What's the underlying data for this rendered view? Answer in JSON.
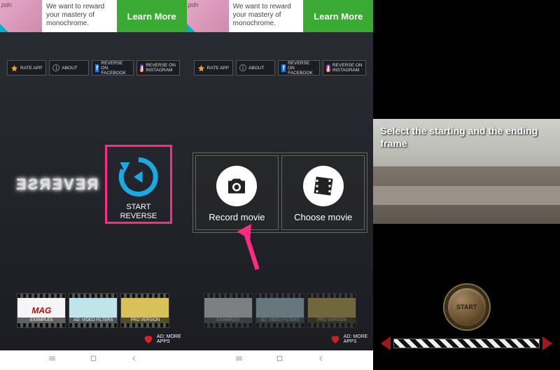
{
  "ad": {
    "text": "We want to reward your mastery of monochrome.",
    "cta": "Learn More"
  },
  "topbuttons": {
    "rate": "RATE APP",
    "about": "ABOUT",
    "fb": "REVERSE ON FACEBOOK",
    "ig": "REVERSE ON INSTAGRAM"
  },
  "logo": "REVERSE",
  "start_reverse": "START\nREVERSE",
  "films": {
    "examples": "EXAMPLES",
    "examples_body": "MAG",
    "filters": "AD: VIDEO FILTERS",
    "pro": "PRO VERSION"
  },
  "more_apps": "AD: MORE\nAPPS",
  "dialog": {
    "record": "Record movie",
    "choose": "Choose movie"
  },
  "screen3": {
    "message": "Select the starting and the ending frame",
    "start": "START"
  }
}
